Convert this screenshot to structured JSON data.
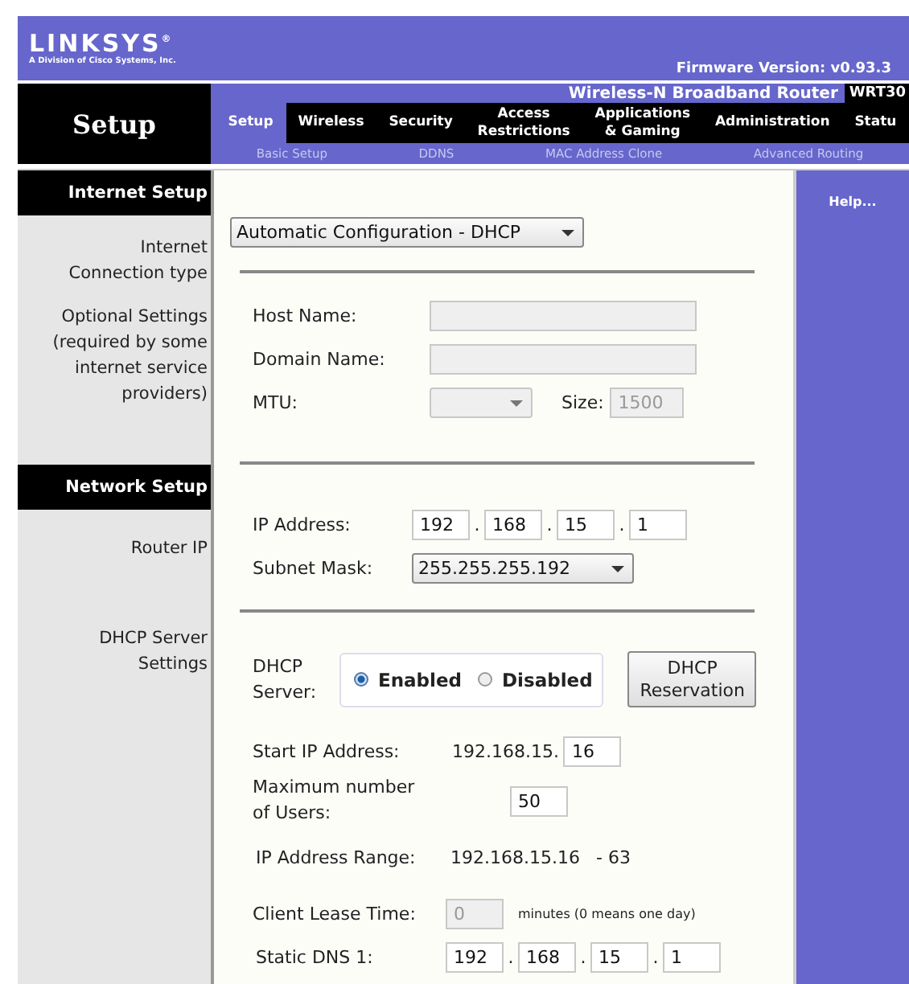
{
  "header": {
    "logo": "LINKSYS",
    "logo_mark": "®",
    "tagline": "A Division of Cisco Systems, Inc.",
    "firmware": "Firmware Version: v0.93.3"
  },
  "nav": {
    "section": "Setup",
    "product": "Wireless-N Broadband Router",
    "model": "WRT30",
    "tabs": [
      {
        "label": "Setup",
        "selected": true
      },
      {
        "label": "Wireless",
        "selected": false
      },
      {
        "label": "Security",
        "selected": false
      },
      {
        "label": "Access\nRestrictions",
        "selected": false
      },
      {
        "label": "Applications\n& Gaming",
        "selected": false
      },
      {
        "label": "Administration",
        "selected": false
      },
      {
        "label": "Statu",
        "selected": false
      }
    ],
    "subtabs": [
      "Basic Setup",
      "DDNS",
      "MAC Address Clone",
      "Advanced Routing"
    ]
  },
  "internet_setup": {
    "heading": "Internet Setup",
    "connection_label": "Internet\nConnection type",
    "connection_type": "Automatic Configuration - DHCP",
    "optional_label": "Optional Settings (required by some internet service providers)",
    "host": {
      "label": "Host Name:",
      "disabled": true
    },
    "domain": {
      "label": "Domain Name:",
      "disabled": true
    },
    "mtu": {
      "label": "MTU:",
      "disabled": true
    },
    "size": {
      "label": "Size:",
      "value": "1500",
      "disabled": true
    }
  },
  "network_setup": {
    "heading": "Network Setup",
    "router_label": "Router IP",
    "ip_label": "IP Address:",
    "ip": [
      "192",
      "168",
      "15",
      "1"
    ],
    "ip_separators": [
      ".",
      ".",
      "."
    ],
    "subnet_label": "Subnet Mask:",
    "subnet": "255.255.255.192",
    "dhcp_label": "DHCP Server\nSettings",
    "server_label": "DHCP Server:",
    "options": [
      {
        "label": "Enabled",
        "selected": true
      },
      {
        "label": "Disabled",
        "selected": false
      }
    ],
    "reservation_button": "DHCP Reservation",
    "start_label": "Start IP Address:",
    "start_prefix": "192.168.15.",
    "start_value": "16",
    "max_label": "Maximum number of Users:",
    "max_value": "50",
    "range_label": "IP Address Range:",
    "range_start": "192.168.15.16",
    "range_end": "- 63",
    "lease_label": "Client Lease Time:",
    "lease": {
      "value": "0",
      "disabled": true
    },
    "lease_note": "minutes (0 means one day)",
    "dns_label": "Static DNS 1:",
    "dns": [
      "192",
      "168",
      "15",
      "1"
    ],
    "dns_separators": [
      ".",
      ".",
      "."
    ]
  },
  "help": "Help..."
}
